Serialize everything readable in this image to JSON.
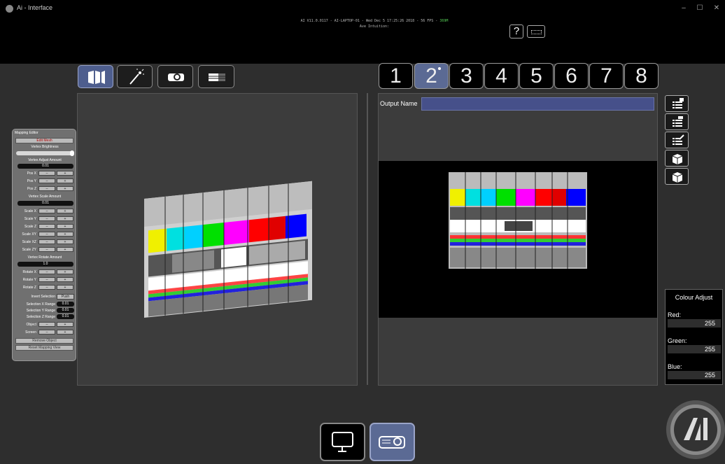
{
  "window": {
    "title": "Ai - Interface",
    "minimize": "–",
    "maximize": "☐",
    "close": "✕"
  },
  "header": {
    "system_info_main": "AI V11.0.0117 - AI-LAPTOP-01 - Wed Dec 5 17:25:26 2018 - 56 FPS -",
    "system_info_fps": "369M",
    "ave_status": "Ave Intuition:",
    "help_label": "?"
  },
  "mode_toolbar": {
    "items": [
      "mapping-icon",
      "magic-wand-icon",
      "projector-icon",
      "led-panel-icon"
    ]
  },
  "output_tabs": [
    {
      "label": "1"
    },
    {
      "label": "2",
      "active": true
    },
    {
      "label": "3"
    },
    {
      "label": "4"
    },
    {
      "label": "5"
    },
    {
      "label": "6"
    },
    {
      "label": "7"
    },
    {
      "label": "8"
    }
  ],
  "output_panel": {
    "name_label": "Output Name",
    "name_value": ""
  },
  "mapping_editor": {
    "title": "Mapping Editor",
    "edit_mesh": "Edit Mesh",
    "vertex_brightness": "Vertex Brightness",
    "vertex_adjust_amount": "Vertex Adjust Amount",
    "vertex_adjust_value": "0.01",
    "pos_rows": [
      "Pos X",
      "Pos Y",
      "Pos Z"
    ],
    "vertex_scale_amount": "Vertex Scale Amount",
    "vertex_scale_value": "0.01",
    "scale_rows": [
      "Scale X",
      "Scale Y",
      "Scale Z",
      "Scale XY",
      "Scale XZ",
      "Scale ZY"
    ],
    "vertex_rotate_amount": "Vertex Rotate Amount",
    "vertex_rotate_value": "1.0",
    "rotate_rows": [
      "Rotate X",
      "Rotate Y",
      "Rotate Z"
    ],
    "minus": "–",
    "plus": "+",
    "invert_selection": "Invert Selection",
    "push": "Push",
    "selection_x_range": "Selection X Range",
    "selection_x_value": "0.01",
    "selection_y_range": "Selection Y Range",
    "selection_y_value": "0.01",
    "selection_z_range": "Selection Z Range",
    "selection_z_value": "0.01",
    "object_label": "Object",
    "screen_label": "Screen",
    "remove_object": "Remove Object",
    "reset_mapping_view": "Reset Mapping View"
  },
  "colour_adjust": {
    "title": "Colour Adjust",
    "red_label": "Red:",
    "red_value": "255",
    "green_label": "Green:",
    "green_value": "255",
    "blue_label": "Blue:",
    "blue_value": "255"
  },
  "side_buttons": [
    "list-export-icon",
    "list-import-icon",
    "list-edit-icon",
    "box-export-icon",
    "box-import-icon"
  ],
  "bottom_buttons": [
    "monitor-icon",
    "projector-icon"
  ],
  "colors": {
    "accent": "#5b6a94",
    "output_name_bg": "#46508a"
  }
}
